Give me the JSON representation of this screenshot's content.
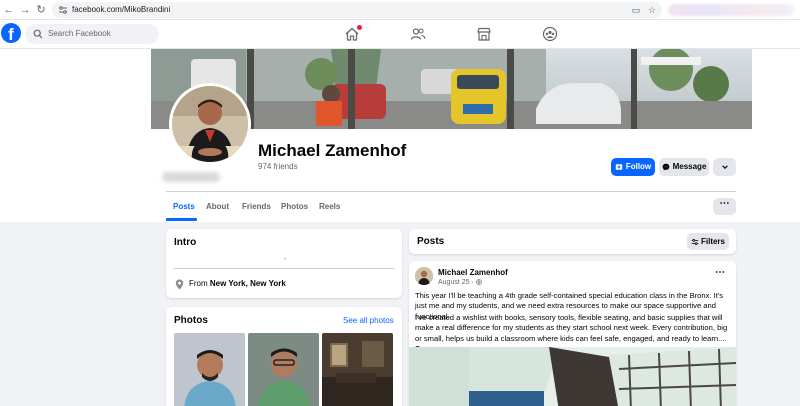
{
  "browser": {
    "url": "facebook.com/MikoBrandini"
  },
  "topbar": {
    "search_placeholder": "Search Facebook"
  },
  "profile": {
    "name": "Michael Zamenhof",
    "friends": "974 friends",
    "follow_label": "Follow",
    "message_label": "Message"
  },
  "tabs": [
    {
      "label": "Posts",
      "active": true
    },
    {
      "label": "About",
      "active": false
    },
    {
      "label": "Friends",
      "active": false
    },
    {
      "label": "Photos",
      "active": false
    },
    {
      "label": "Reels",
      "active": false
    }
  ],
  "intro": {
    "title": "Intro",
    "placeholder_dash": "-",
    "from_prefix": "From",
    "from_location": "New York, New York"
  },
  "photos": {
    "title": "Photos",
    "see_all": "See all photos"
  },
  "posts": {
    "title": "Posts",
    "filters_label": "Filters",
    "post": {
      "author": "Michael Zamenhof",
      "date": "August 25",
      "paragraph1": "This year I'll be teaching a 4th grade self-contained special education class in the Bronx. It's just me and my students, and we need extra resources to make our space supportive and functional.",
      "paragraph2": "I've created a wishlist with books, sensory tools, flexible seating, and basic supplies that will make a real difference for my students as they start school next week. Every contribution, big or small, helps us build a classroom where kids can feel safe, engaged, and ready to learn....",
      "see_more": "See more"
    }
  },
  "colors": {
    "brand": "#0866ff",
    "notification": "#e41e3f",
    "background": "#f0f2f5"
  }
}
